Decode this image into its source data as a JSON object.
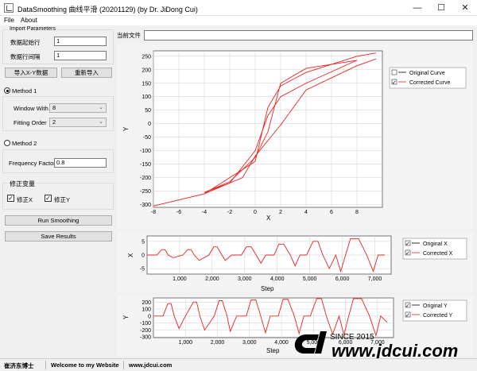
{
  "window": {
    "title": "DataSmoothing 曲线平滑 (20201129) (by Dr. JiDong Cui)",
    "minimize_icon": "minimize-icon",
    "maximize_icon": "maximize-icon",
    "close_icon": "close-icon"
  },
  "menu": [
    "File",
    "About"
  ],
  "import": {
    "group_title": "Import Parameters",
    "start_row_label": "数据起始行",
    "start_row_value": "1",
    "row_interval_label": "数据行间隔",
    "row_interval_value": "1",
    "import_button": "导入X-Y数据",
    "reimport_button": "重新导入"
  },
  "method1": {
    "label": "Method 1",
    "selected": true,
    "window_label": "Window With",
    "window_value": "8",
    "order_label": "Fitting Order",
    "order_value": "2"
  },
  "method2": {
    "label": "Method 2",
    "selected": false,
    "freq_label": "Frequency Factor",
    "freq_value": "0.8"
  },
  "correct": {
    "title": "修正变量",
    "x_label": "修正X",
    "x_checked": true,
    "y_label": "修正Y",
    "y_checked": true
  },
  "actions": {
    "run": "Run Smoothing",
    "save": "Save Results"
  },
  "file_bar": {
    "label": "当前文件",
    "value": ""
  },
  "status": {
    "author": "崔济东博士",
    "welcome": "Welcome to my Website",
    "url": "www.jdcui.com"
  },
  "watermark": {
    "since": "SINCE 2015",
    "site": "www.jdcui.com"
  },
  "colors": {
    "original": "#000000",
    "corrected": "#e8231f"
  },
  "chart_data": [
    {
      "type": "line",
      "x_axis_label": "X",
      "y_axis_label": "Y",
      "xlim": [
        -8,
        10
      ],
      "ylim": [
        -310,
        270
      ],
      "x_ticks": [
        -8,
        -6,
        -4,
        -2,
        0,
        2,
        4,
        6,
        8
      ],
      "y_ticks": [
        250,
        200,
        150,
        100,
        50,
        0,
        -50,
        -100,
        -150,
        -200,
        -250,
        -300
      ],
      "grid": true,
      "legend_position": "top-right",
      "legend": [
        {
          "name": "Original Curve",
          "checked": false
        },
        {
          "name": "Corrected Curve",
          "checked": true
        }
      ],
      "series": [
        {
          "name": "Corrected Curve",
          "loops": [
            {
              "x": [
                -8,
                -4,
                0,
                1,
                2,
                4,
                8,
                9.5
              ],
              "y": [
                -305,
                -260,
                -140,
                60,
                140,
                190,
                250,
                262
              ]
            },
            {
              "x": [
                9.5,
                8,
                4,
                2,
                0,
                -1,
                -4
              ],
              "y": [
                240,
                215,
                125,
                -5,
                -120,
                -200,
                -260
              ]
            },
            {
              "x": [
                -4,
                -2,
                0,
                1,
                2,
                4,
                8
              ],
              "y": [
                -255,
                -220,
                -100,
                30,
                100,
                150,
                235
              ]
            },
            {
              "x": [
                8,
                4,
                2,
                1,
                0,
                -2,
                -4
              ],
              "y": [
                235,
                205,
                150,
                -30,
                -125,
                -215,
                -255
              ]
            }
          ]
        }
      ]
    },
    {
      "type": "line",
      "x_axis_label": "Step",
      "y_axis_label": "X",
      "xlim": [
        0,
        7500
      ],
      "ylim": [
        -7,
        7
      ],
      "x_ticks": [
        1000,
        2000,
        3000,
        4000,
        5000,
        6000,
        7000
      ],
      "y_ticks": [
        5,
        0,
        -5
      ],
      "grid": true,
      "legend_position": "top-right",
      "legend": [
        {
          "name": "Original X",
          "checked": true
        },
        {
          "name": "Corrected X",
          "checked": true
        }
      ],
      "series": [
        {
          "name": "Corrected X",
          "x": [
            0,
            300,
            450,
            550,
            650,
            800,
            1100,
            1250,
            1350,
            1450,
            1600,
            1900,
            2050,
            2150,
            2300,
            2400,
            2600,
            2900,
            3050,
            3200,
            3350,
            3500,
            3650,
            3900,
            4050,
            4200,
            4400,
            4550,
            4700,
            4900,
            5100,
            5250,
            5400,
            5600,
            5800,
            5950,
            6100,
            6250,
            6500,
            6750,
            6950,
            7100,
            7300
          ],
          "y": [
            0,
            0,
            2,
            2,
            0,
            -1,
            0,
            2,
            2,
            0,
            -2,
            0,
            3,
            3,
            0,
            -2,
            0,
            0,
            3,
            3,
            0,
            -3,
            0,
            0,
            4,
            4,
            0,
            -4,
            0,
            0,
            5,
            5,
            0,
            -5,
            0,
            -6,
            0,
            6,
            6,
            0,
            -6,
            0,
            0
          ]
        }
      ]
    },
    {
      "type": "line",
      "x_axis_label": "Step",
      "y_axis_label": "Y",
      "xlim": [
        0,
        7500
      ],
      "ylim": [
        -310,
        260
      ],
      "x_ticks": [
        1000,
        2000,
        3000,
        4000,
        5000,
        6000,
        7000
      ],
      "y_ticks": [
        200,
        100,
        0,
        -100,
        -200,
        -300
      ],
      "grid": true,
      "legend_position": "top-right",
      "legend": [
        {
          "name": "Original Y",
          "checked": true
        },
        {
          "name": "Corrected Y",
          "checked": true
        }
      ],
      "series": [
        {
          "name": "Corrected Y",
          "x": [
            0,
            300,
            450,
            550,
            650,
            800,
            1000,
            1250,
            1350,
            1450,
            1600,
            1900,
            2050,
            2150,
            2300,
            2400,
            2600,
            2900,
            3050,
            3200,
            3350,
            3500,
            3650,
            3900,
            4050,
            4200,
            4400,
            4550,
            4700,
            4900,
            5100,
            5250,
            5400,
            5600,
            5800,
            5950,
            6100,
            6250,
            6500,
            6750,
            6950,
            7100,
            7300
          ],
          "y": [
            0,
            0,
            180,
            180,
            0,
            -180,
            0,
            200,
            200,
            0,
            -200,
            0,
            220,
            220,
            0,
            -220,
            0,
            0,
            230,
            230,
            0,
            -240,
            0,
            0,
            240,
            240,
            0,
            -250,
            0,
            0,
            250,
            250,
            0,
            -260,
            0,
            -270,
            0,
            250,
            250,
            0,
            -280,
            0,
            -90
          ]
        }
      ]
    }
  ]
}
